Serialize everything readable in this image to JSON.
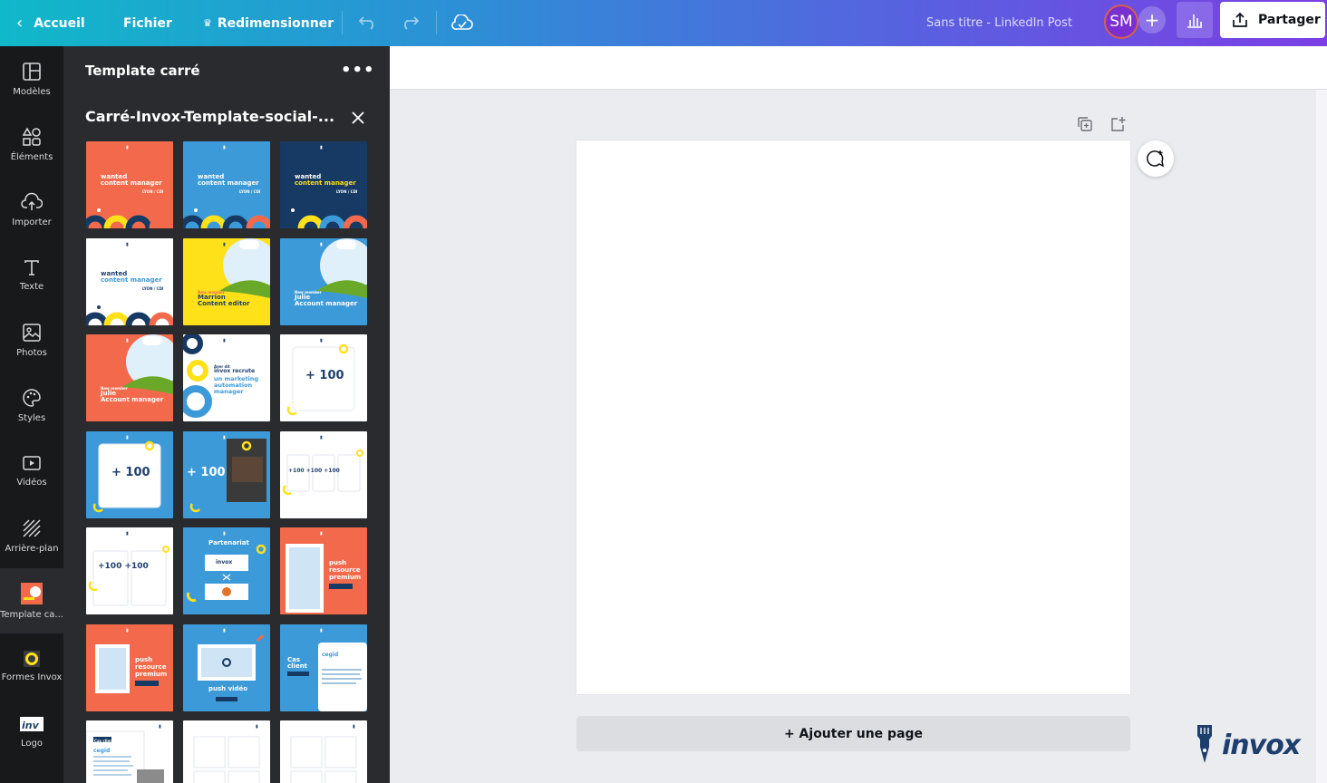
{
  "topbar": {
    "back_label": "Accueil",
    "file_label": "Fichier",
    "resize_label": "Redimensionner",
    "doc_title": "Sans titre - LinkedIn Post",
    "avatar_initials": "SM",
    "add_user": "+",
    "share_label": "Partager"
  },
  "rail": {
    "items": [
      {
        "label": "Modèles",
        "icon": "layout-icon"
      },
      {
        "label": "Éléments",
        "icon": "shapes-icon"
      },
      {
        "label": "Importer",
        "icon": "upload-cloud-icon"
      },
      {
        "label": "Texte",
        "icon": "text-icon"
      },
      {
        "label": "Photos",
        "icon": "image-icon"
      },
      {
        "label": "Styles",
        "icon": "palette-icon"
      },
      {
        "label": "Vidéos",
        "icon": "video-icon"
      },
      {
        "label": "Arrière-plan",
        "icon": "background-icon"
      },
      {
        "label": "Template ca...",
        "icon": "template-thumb-icon"
      },
      {
        "label": "Formes Invox",
        "icon": "invox-shapes-icon"
      },
      {
        "label": "Logo",
        "icon": "invox-logo-icon"
      }
    ]
  },
  "panel": {
    "title": "Template carré",
    "more": "•••",
    "folder_title": "Carré-Invox-Template-social-...",
    "thumbs": [
      {
        "bg": "#f26a4b",
        "l1": "wanted",
        "l2": "content manager",
        "l3": "LYON / CDI",
        "deco": "rings"
      },
      {
        "bg": "#3d9ad9",
        "l1": "wanted",
        "l2": "content manager",
        "l3": "LYON / CDI",
        "deco": "rings"
      },
      {
        "bg": "#163a63",
        "l1": "wanted",
        "l2": "content manager",
        "l3": "LYON / CDI",
        "deco": "rings"
      },
      {
        "bg": "#ffffff",
        "l1": "wanted",
        "l2": "content manager",
        "l3": "LYON / CDI",
        "deco": "rings"
      },
      {
        "bg": "#ffe11a",
        "l1": "New member",
        "l2": "Marrion",
        "l3": "Content editor",
        "deco": "hill"
      },
      {
        "bg": "#3d9ad9",
        "l1": "New member",
        "l2": "Julie",
        "l3": "Account manager",
        "deco": "hill"
      },
      {
        "bg": "#f26a4b",
        "l1": "New member",
        "l2": "Julie",
        "l3": "Account manager",
        "deco": "hill"
      },
      {
        "bg": "#ffffff",
        "l1": "Ayer dit",
        "l2": "invox recrute",
        "l3": "un marketing automation manager",
        "deco": "circles"
      },
      {
        "bg": "#ffffff",
        "l1": "",
        "l2": "+ 100",
        "l3": "",
        "deco": "card"
      },
      {
        "bg": "#3d9ad9",
        "l1": "",
        "l2": "+ 100",
        "l3": "",
        "deco": "card"
      },
      {
        "bg": "#3d9ad9",
        "l1": "",
        "l2": "+ 100",
        "l3": "",
        "deco": "photo"
      },
      {
        "bg": "#ffffff",
        "l1": "",
        "l2": "+100  +100  +100",
        "l3": "",
        "deco": "cards3"
      },
      {
        "bg": "#ffffff",
        "l1": "",
        "l2": "+100   +100",
        "l3": "",
        "deco": "cards2"
      },
      {
        "bg": "#3d9ad9",
        "l1": "Partenariat",
        "l2": "invox",
        "l3": "",
        "deco": "partner"
      },
      {
        "bg": "#f26a4b",
        "l1": "push",
        "l2": "resource",
        "l3": "premium",
        "deco": "doc"
      },
      {
        "bg": "#f26a4b",
        "l1": "push",
        "l2": "resource",
        "l3": "premium",
        "deco": "frame"
      },
      {
        "bg": "#3d9ad9",
        "l1": "push vidéo",
        "l2": "",
        "l3": "",
        "deco": "video"
      },
      {
        "bg": "#3d9ad9",
        "l1": "Cas",
        "l2": "client",
        "l3": "cegid",
        "deco": "case"
      },
      {
        "bg": "#ffffff",
        "l1": "Cas client",
        "l2": "cegid",
        "l3": "",
        "deco": "case2"
      },
      {
        "bg": "#ffffff",
        "l1": "",
        "l2": "",
        "l3": "",
        "deco": "blank"
      },
      {
        "bg": "#ffffff",
        "l1": "",
        "l2": "",
        "l3": "",
        "deco": "blank"
      }
    ]
  },
  "canvas": {
    "add_page_label": "+ Ajouter une page"
  },
  "brand": {
    "logo_text": "invox"
  },
  "colors": {
    "accent_orange": "#f26a4b",
    "accent_blue": "#3d9ad9",
    "navy": "#163a63",
    "yellow": "#ffe11a"
  }
}
